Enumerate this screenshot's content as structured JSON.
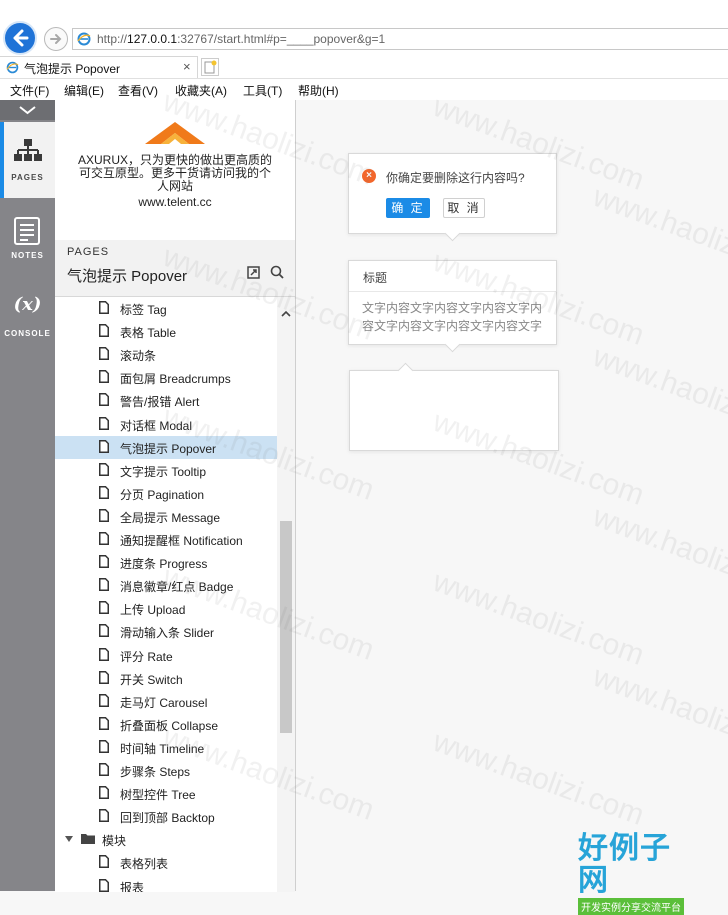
{
  "browser": {
    "url_prefix": "http://",
    "url_host": "127.0.0.1",
    "url_rest": ":32767/start.html#p=____popover&g=1",
    "tab_title": "气泡提示 Popover",
    "tab_close": "×",
    "menu": [
      "文件(F)",
      "编辑(E)",
      "查看(V)",
      "收藏夹(A)",
      "工具(T)",
      "帮助(H)"
    ]
  },
  "rail": {
    "tabs": [
      {
        "label": "PAGES",
        "icon": "sitemap-icon"
      },
      {
        "label": "NOTES",
        "icon": "notes-icon"
      },
      {
        "label": "CONSOLE",
        "icon": "console-icon",
        "glyph": "(x)"
      }
    ]
  },
  "sidebar": {
    "logo_text": "AXURUX，只为更快的做出更高质的可交互原型。更多干货请访问我的个人网站",
    "logo_url": "www.telent.cc",
    "pages_caption": "PAGES",
    "current_page": "气泡提示 Popover",
    "pages": [
      "标签 Tag",
      "表格 Table",
      "滚动条",
      "面包屑 Breadcrumps",
      "警告/报错 Alert",
      "对话框 Modal",
      "气泡提示 Popover",
      "文字提示 Tooltip",
      "分页 Pagination",
      "全局提示 Message",
      "通知提醒框 Notification",
      "进度条 Progress",
      "消息徽章/红点 Badge",
      "上传 Upload",
      "滑动输入条 Slider",
      "评分 Rate",
      "开关 Switch",
      "走马灯 Carousel",
      "折叠面板 Collapse",
      "时间轴 Timeline",
      "步骤条 Steps",
      "树型控件 Tree",
      "回到顶部 Backtop"
    ],
    "selected_index": 6,
    "folder": "模块",
    "folder_pages": [
      "表格列表",
      "报表"
    ]
  },
  "canvas": {
    "confirm_popover": {
      "message": "你确定要删除这行内容吗?",
      "ok_label": "确 定",
      "cancel_label": "取 消"
    },
    "card_popover": {
      "title": "标题",
      "body": "文字内容文字内容文字内容文字内容文字内容文字内容文字内容文字"
    }
  },
  "watermark": {
    "text": "www.haolizi.com",
    "brand": "好例子网",
    "brand_sub": "开发实例分享交流平台"
  },
  "colors": {
    "accent": "#1b8be6",
    "selected_row": "#cbe1f3",
    "rail": "#858589",
    "warning": "#f2662b"
  }
}
